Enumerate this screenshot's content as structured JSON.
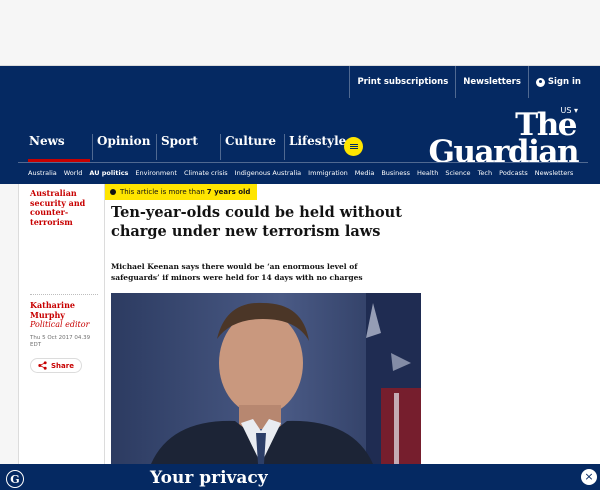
{
  "topbar": {
    "print_subscriptions": "Print subscriptions",
    "newsletters": "Newsletters",
    "sign_in": "Sign in"
  },
  "masthead": {
    "edition": "US ▾",
    "logo_the": "The",
    "logo_guardian": "Guardian",
    "pillars": [
      "News",
      "Opinion",
      "Sport",
      "Culture",
      "Lifestyle"
    ],
    "active_pillar": "News",
    "menu_icon": "hamburger-icon"
  },
  "subnav": {
    "items": [
      "Australia",
      "World",
      "AU politics",
      "Environment",
      "Climate crisis",
      "Indigenous Australia",
      "Immigration",
      "Media",
      "Business",
      "Health",
      "Science",
      "Tech",
      "Podcasts",
      "Newsletters"
    ],
    "current": "AU politics"
  },
  "article": {
    "series": "Australian security and counter-terrorism",
    "age_warning_prefix": "This article is more than",
    "age_warning_age": "7 years old",
    "headline": "Ten-year-olds could be held without charge under new terrorism laws",
    "standfirst": "Michael Keenan says there would be ‘an enormous level of safeguards’ if minors were held for 14 days with no charges",
    "byline_name": "Katharine Murphy",
    "byline_role": "Political editor",
    "date": "Thu 5 Oct 2017 04.39 EDT",
    "share_label": "Share"
  },
  "consent": {
    "title": "Your privacy",
    "close_icon": "close-icon"
  },
  "colors": {
    "brand_blue": "#052962",
    "news_red": "#c70000",
    "highlight_yellow": "#ffe500"
  }
}
